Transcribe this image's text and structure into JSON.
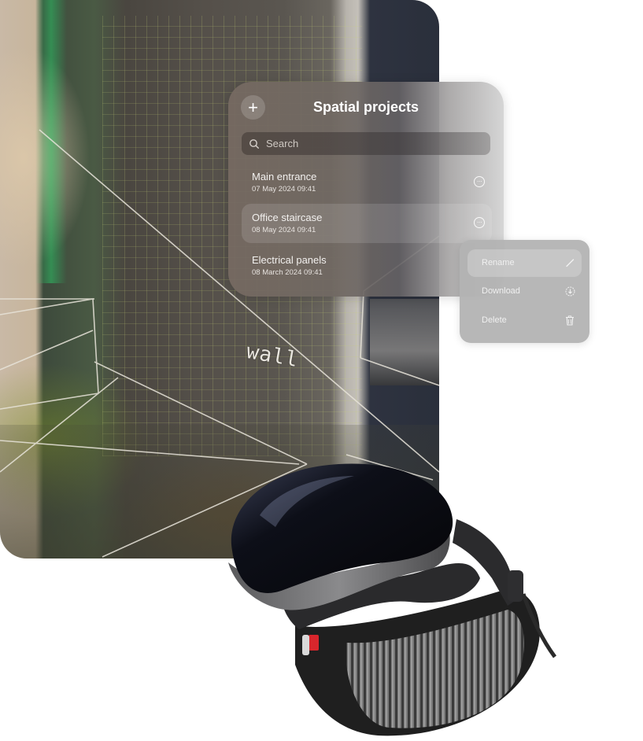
{
  "background": {
    "scan_label": "wall"
  },
  "panel": {
    "title": "Spatial projects",
    "add_button_icon": "plus-icon",
    "search": {
      "placeholder": "Search",
      "value": "",
      "icon": "search-icon"
    },
    "items": [
      {
        "name": "Main entrance",
        "date": "07 May 2024 09:41",
        "selected": false,
        "more_icon": "ellipsis-circle-icon"
      },
      {
        "name": "Office staircase",
        "date": "08 May 2024 09:41",
        "selected": true,
        "more_icon": "ellipsis-circle-icon"
      },
      {
        "name": "Electrical panels",
        "date": "08 March 2024 09:41",
        "selected": false,
        "more_icon": "ellipsis-circle-icon"
      }
    ]
  },
  "context_menu": {
    "items": [
      {
        "label": "Rename",
        "icon": "pencil-icon",
        "active": true
      },
      {
        "label": "Download",
        "icon": "download-circle-icon",
        "active": false
      },
      {
        "label": "Delete",
        "icon": "trash-icon",
        "active": false
      }
    ]
  },
  "device": {
    "name": "vr-headset-image"
  }
}
